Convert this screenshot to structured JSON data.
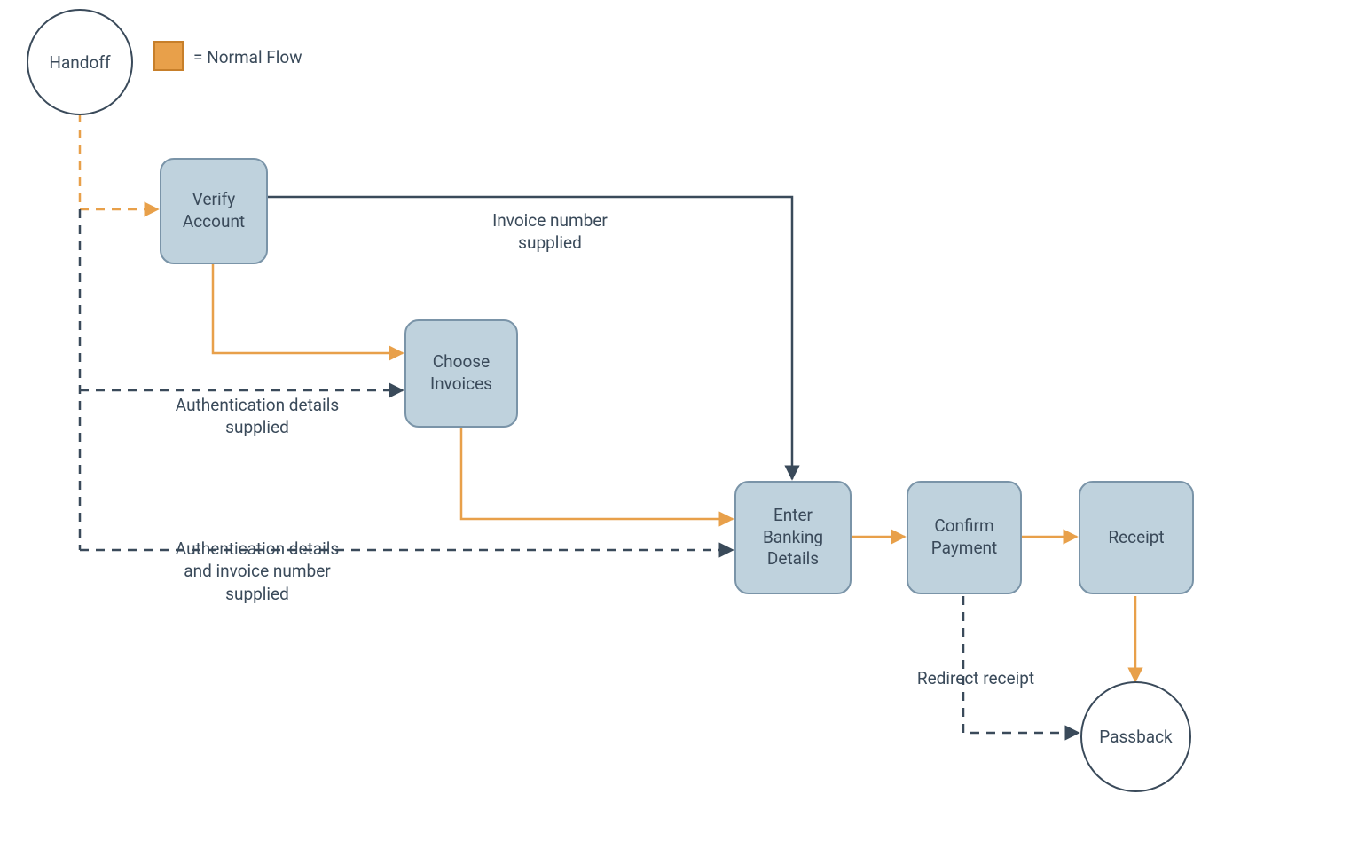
{
  "legend": {
    "label": "= Normal Flow"
  },
  "nodes": {
    "handoff": "Handoff",
    "verify_account": "Verify\nAccount",
    "choose_invoices": "Choose\nInvoices",
    "enter_banking": "Enter\nBanking\nDetails",
    "confirm_payment": "Confirm\nPayment",
    "receipt": "Receipt",
    "passback": "Passback"
  },
  "edges": {
    "invoice_number_supplied": "Invoice number\nsupplied",
    "auth_details_supplied": "Authentication details\nsupplied",
    "auth_invoice_supplied": "Authentication details\nand invoice number\nsupplied",
    "redirect_receipt": "Redirect receipt"
  },
  "colors": {
    "orange": "#e8a04a",
    "blue_fill": "#bfd2dd",
    "blue_stroke": "#7a94a8",
    "dark": "#3a4a5a"
  }
}
